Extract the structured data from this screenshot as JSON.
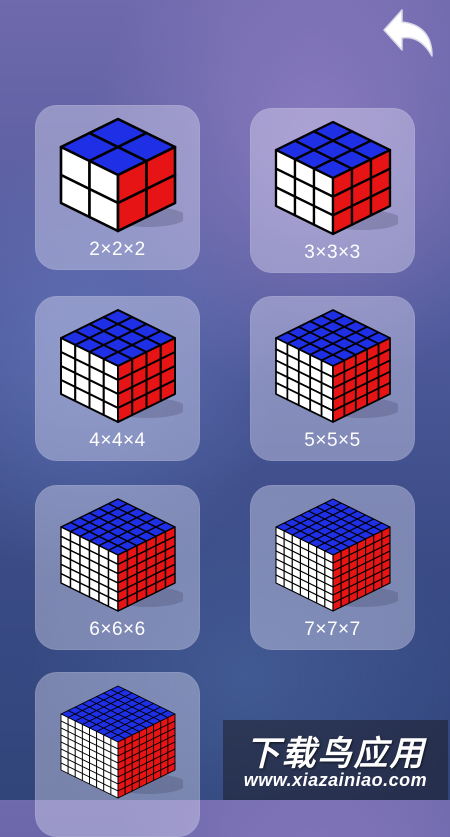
{
  "icons": {
    "back": "back-arrow-icon"
  },
  "colors": {
    "top": "#1f2fe6",
    "left": "#ffffff",
    "right": "#e61414",
    "grid": "#000000"
  },
  "cubes": [
    {
      "label": "2×2×2",
      "size": 2
    },
    {
      "label": "3×3×3",
      "size": 3
    },
    {
      "label": "4×4×4",
      "size": 4
    },
    {
      "label": "5×5×5",
      "size": 5
    },
    {
      "label": "6×6×6",
      "size": 6
    },
    {
      "label": "7×7×7",
      "size": 7
    },
    {
      "label": "",
      "size": 8
    }
  ],
  "watermark": {
    "title": "下载鸟应用",
    "url": "www.xiazainiao.com"
  }
}
